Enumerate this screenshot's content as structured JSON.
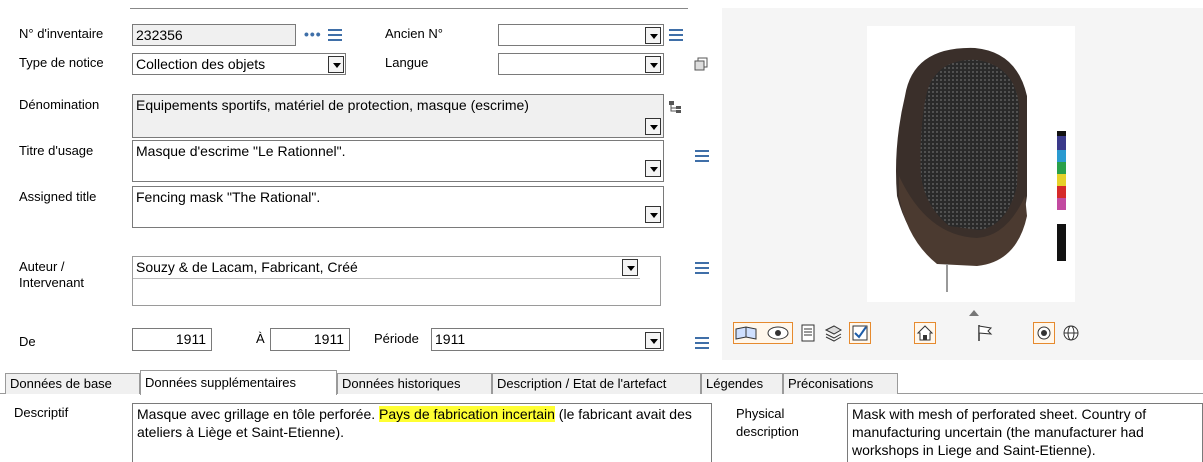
{
  "fields": {
    "inventaire": {
      "label": "N° d'inventaire",
      "value": "232356"
    },
    "ancien": {
      "label": "Ancien N°",
      "value": ""
    },
    "type_notice": {
      "label": "Type de notice",
      "value": "Collection des objets"
    },
    "langue": {
      "label": "Langue",
      "value": ""
    },
    "denomination": {
      "label": "Dénomination",
      "value": "Equipements sportifs, matériel de protection, masque (escrime)"
    },
    "titre_usage": {
      "label": "Titre d'usage",
      "value": "Masque d'escrime \"Le Rationnel\"."
    },
    "assigned_title": {
      "label": "Assigned title",
      "value": "Fencing mask \"The Rational\"."
    },
    "auteur": {
      "label": "Auteur / Intervenant",
      "value": "Souzy & de Lacam, Fabricant, Créé"
    },
    "de": {
      "label": "De",
      "value": "1911"
    },
    "a": {
      "label": "À",
      "value": "1911"
    },
    "periode": {
      "label": "Période",
      "value": "1911"
    }
  },
  "tabs": [
    {
      "label": "Données de base",
      "active": false
    },
    {
      "label": "Données supplémentaires",
      "active": true
    },
    {
      "label": "Données historiques",
      "active": false
    },
    {
      "label": "Description / Etat de l'artefact",
      "active": false
    },
    {
      "label": "Légendes",
      "active": false
    },
    {
      "label": "Préconisations",
      "active": false
    }
  ],
  "descriptif": {
    "label": "Descriptif",
    "text_before": "Masque avec grillage en tôle perforée. ",
    "text_highlight": "Pays de fabrication incertain",
    "text_after": " (le fabricant avait des ateliers à Liège et Saint-Etienne)."
  },
  "physical": {
    "label": "Physical description",
    "text": "Mask with mesh of perforated sheet. Country of manufacturing uncertain (the manufacturer had workshops in Liege and Saint-Etienne)."
  },
  "toolbar_icons": [
    "book-icon",
    "eye-icon",
    "document-icon",
    "stack-icon",
    "checkbox-icon",
    "home-icon",
    "flag-icon",
    "record-icon",
    "globe-icon"
  ],
  "colors": {
    "accent_icon": "#3f6fa8",
    "highlight": "#ffff33",
    "toolbar_border": "#e68a2e"
  }
}
